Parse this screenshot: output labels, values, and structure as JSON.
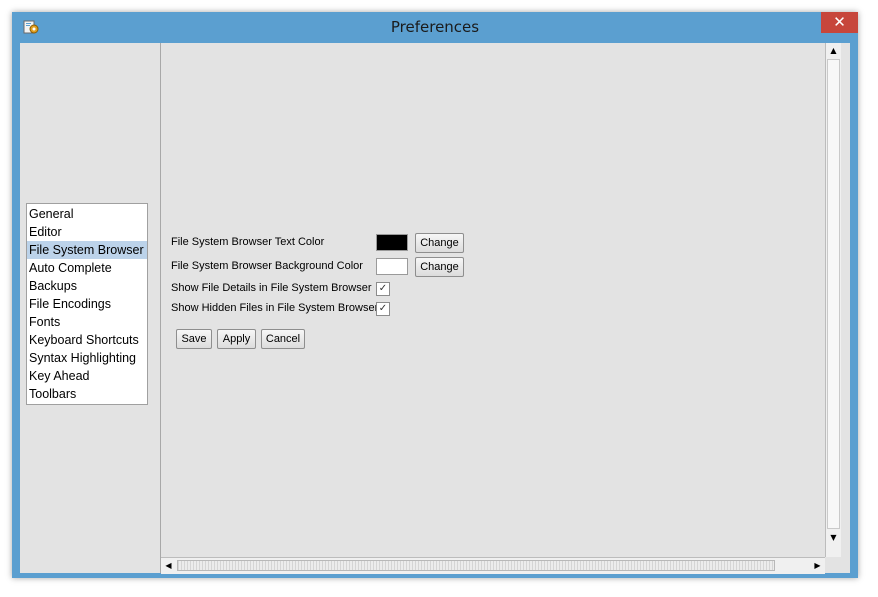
{
  "window": {
    "title": "Preferences",
    "close_glyph": "✕",
    "app_icon": "preferences-app-icon"
  },
  "sidebar": {
    "selected_index": 2,
    "items": [
      {
        "label": "General"
      },
      {
        "label": "Editor"
      },
      {
        "label": "File System Browser"
      },
      {
        "label": "Auto Complete"
      },
      {
        "label": "Backups"
      },
      {
        "label": "File Encodings"
      },
      {
        "label": "Fonts"
      },
      {
        "label": "Keyboard Shortcuts"
      },
      {
        "label": "Syntax Highlighting"
      },
      {
        "label": "Key Ahead"
      },
      {
        "label": "Toolbars"
      }
    ]
  },
  "settings": {
    "text_color": {
      "label": "File System Browser Text Color",
      "value": "#000000",
      "button": "Change"
    },
    "background_color": {
      "label": "File System Browser Background Color",
      "value": "#ffffff",
      "button": "Change"
    },
    "show_file_details": {
      "label": "Show File Details in File System Browser",
      "checked": true,
      "glyph": "✓"
    },
    "show_hidden_files": {
      "label": "Show Hidden Files in File System Browser",
      "checked": true,
      "glyph": "✓"
    }
  },
  "actions": {
    "save": "Save",
    "apply": "Apply",
    "cancel": "Cancel"
  },
  "scrollbars": {
    "up": "▲",
    "down": "▼",
    "left": "◀",
    "right": "▶"
  }
}
